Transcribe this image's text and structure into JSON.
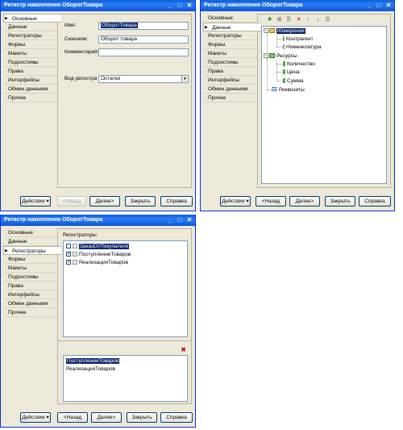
{
  "colors": {
    "titlebar": "#0a5fdf",
    "selection": "#0a246a",
    "window_bg": "#ece9d8"
  },
  "window1": {
    "title": "Регистр накопления ОборотТовара",
    "tabs": [
      {
        "label": "Основные",
        "active": true
      },
      {
        "label": "Данные"
      },
      {
        "label": "Регистраторы"
      },
      {
        "label": "Формы"
      },
      {
        "label": "Макеты"
      },
      {
        "label": "Подсистемы"
      },
      {
        "label": "Права"
      },
      {
        "label": "Интерфейсы"
      },
      {
        "label": "Обмен данными"
      },
      {
        "label": "Прочее"
      }
    ],
    "name_label": "Имя:",
    "name_value": "ОборотТовара",
    "synonym_label": "Синоним:",
    "synonym_value": "Оборот товара",
    "comment_label": "Комментарий:",
    "comment_value": "",
    "kind_label": "Вид регистра",
    "kind_value": "Остатки",
    "buttons": {
      "actions": "Действия",
      "back": "<Назад",
      "next": "Далее>",
      "close": "Закрыть",
      "help": "Справка"
    }
  },
  "window2": {
    "title": "Регистр накопления ОборотТовара",
    "tabs": [
      {
        "label": "Основные"
      },
      {
        "label": "Данные",
        "active": true
      },
      {
        "label": "Регистраторы"
      },
      {
        "label": "Формы"
      },
      {
        "label": "Макеты"
      },
      {
        "label": "Подсистемы"
      },
      {
        "label": "Права"
      },
      {
        "label": "Интерфейсы"
      },
      {
        "label": "Обмен данными"
      },
      {
        "label": "Прочее"
      }
    ],
    "tree": {
      "dimensions": "Измерения",
      "dim_items": [
        "Контрагент",
        "Номенклатура"
      ],
      "resources": "Ресурсы",
      "res_items": [
        "Количество",
        "Цена",
        "Сумма"
      ],
      "attributes": "Реквизиты"
    },
    "buttons": {
      "actions": "Действия",
      "back": "<Назад",
      "next": "Далее>",
      "close": "Закрыть",
      "help": "Справка"
    }
  },
  "window3": {
    "title": "Регистр накопления ОборотТовара",
    "tabs": [
      {
        "label": "Основные"
      },
      {
        "label": "Данные"
      },
      {
        "label": "Регистраторы",
        "active": true
      },
      {
        "label": "Формы"
      },
      {
        "label": "Макеты"
      },
      {
        "label": "Подсистемы"
      },
      {
        "label": "Права"
      },
      {
        "label": "Интерфейсы"
      },
      {
        "label": "Обмен данными"
      },
      {
        "label": "Прочее"
      }
    ],
    "registrars_label": "Регистраторы",
    "registrars": [
      {
        "label": "ЗаказОтПокупателя",
        "checked": false,
        "selected": true
      },
      {
        "label": "ПоступлениеТоваров",
        "checked": true
      },
      {
        "label": "РеализацияТоваров",
        "checked": true
      }
    ],
    "bottom_list": [
      "ПоступлениеТоваров",
      "РеализацияТоваров"
    ],
    "buttons": {
      "actions": "Действия",
      "back": "<Назад",
      "next": "Далее>",
      "close": "Закрыть",
      "help": "Справка"
    }
  }
}
